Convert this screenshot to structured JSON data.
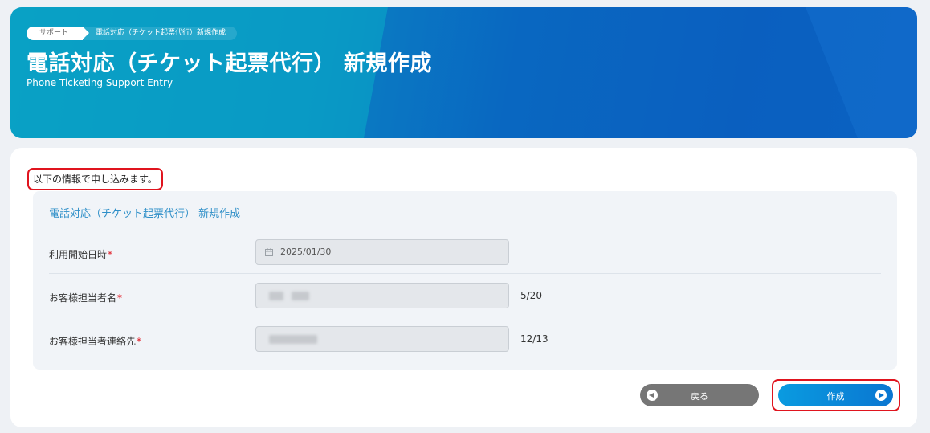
{
  "header": {
    "breadcrumb": {
      "home": "サポート",
      "current": "電話対応（チケット起票代行）新規作成"
    },
    "title": "電話対応（チケット起票代行） 新規作成",
    "subtitle": "Phone Ticketing Support Entry"
  },
  "main": {
    "intro": "以下の情報で申し込みます。",
    "section_title": "電話対応（チケット起票代行） 新規作成",
    "required_mark": "*",
    "fields": [
      {
        "label": "利用開始日時",
        "value": "2025/01/30",
        "icon": "calendar-icon"
      },
      {
        "label": "お客様担当者名",
        "value": "",
        "counter": "5/20",
        "obscured": true
      },
      {
        "label": "お客様担当者連絡先",
        "value": "",
        "counter": "12/13",
        "obscured": true
      }
    ]
  },
  "actions": {
    "back_label": "戻る",
    "create_label": "作成"
  },
  "colors": {
    "accent": "#0a76d1",
    "highlight": "#e0141e",
    "section_title": "#2f8fc8",
    "back_button": "#767676"
  }
}
